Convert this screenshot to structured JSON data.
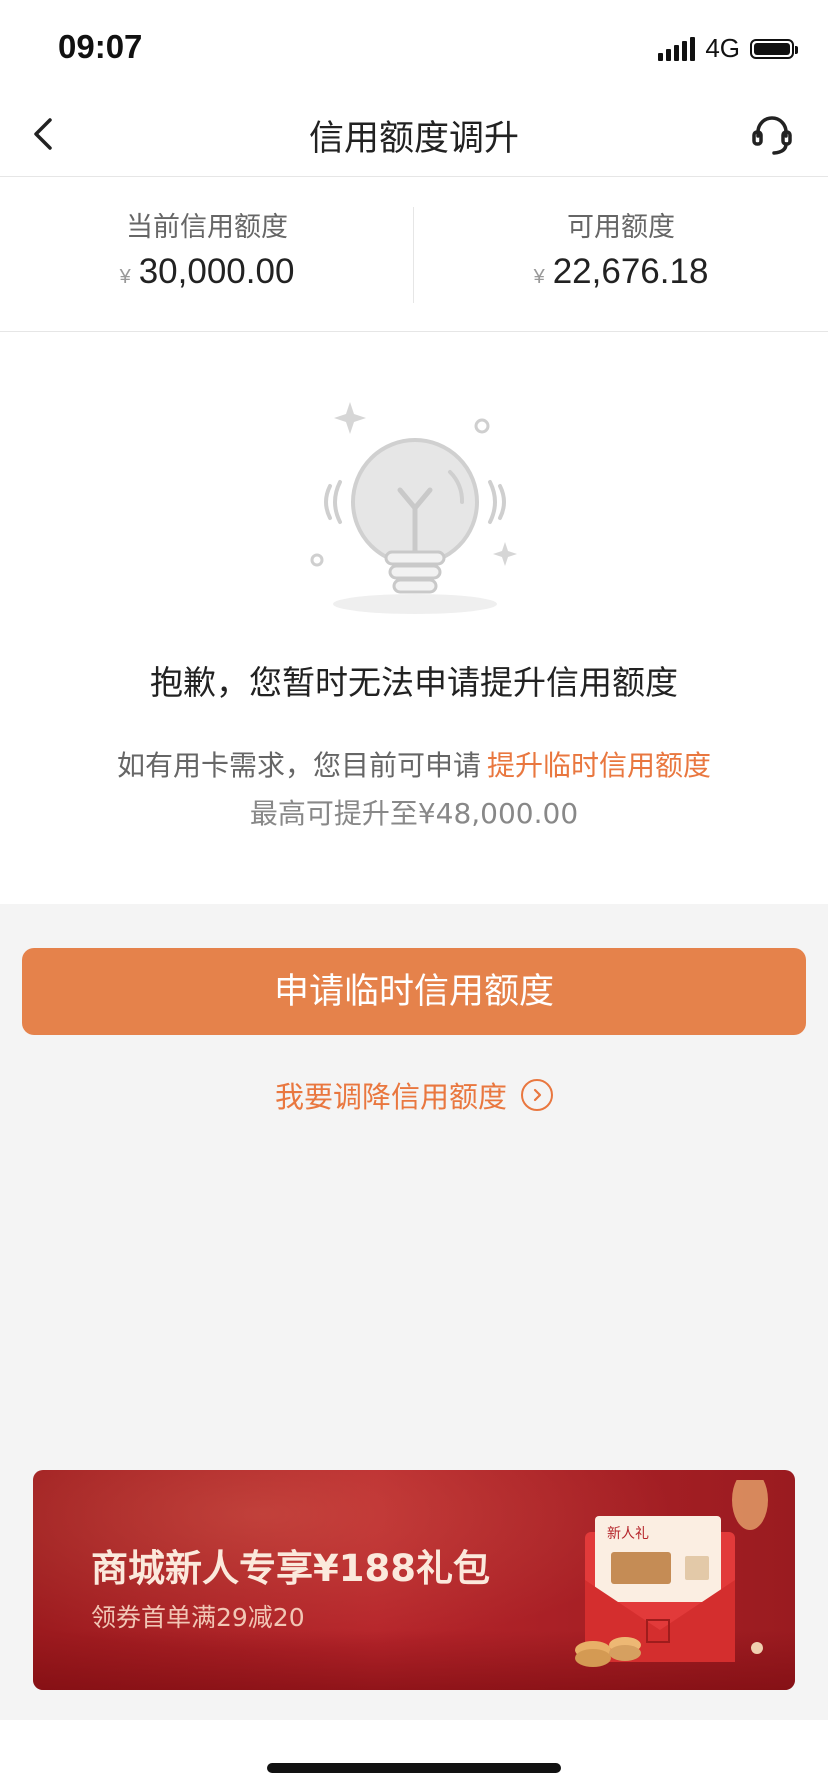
{
  "status_bar": {
    "time": "09:07",
    "network": "4G",
    "icons": [
      "signal-icon",
      "battery-icon"
    ]
  },
  "nav": {
    "title": "信用额度调升",
    "back_icon": "chevron-left-icon",
    "service_icon": "headset-icon"
  },
  "limits": {
    "current": {
      "label": "当前信用额度",
      "currency": "¥",
      "amount": "30,000.00"
    },
    "available": {
      "label": "可用额度",
      "currency": "¥",
      "amount": "22,676.18"
    }
  },
  "notice": {
    "illustration_icon": "lightbulb-icon",
    "title": "抱歉，您暂时无法申请提升信用额度",
    "line1_prefix": "如有用卡需求，您目前可申请",
    "line1_link": "提升临时信用额度",
    "line2": "最高可提升至¥48,000.00"
  },
  "actions": {
    "primary_label": "申请临时信用额度",
    "secondary_label": "我要调降信用额度",
    "secondary_icon": "circle-chevron-right-icon"
  },
  "banner": {
    "title": "商城新人专享¥188礼包",
    "subtitle": "领券首单满29减20",
    "art_label": "新人礼"
  },
  "colors": {
    "accent": "#e9773f",
    "primary_button": "#e5824b",
    "banner_red": "#b5242a",
    "page_bg": "#f4f4f4"
  }
}
